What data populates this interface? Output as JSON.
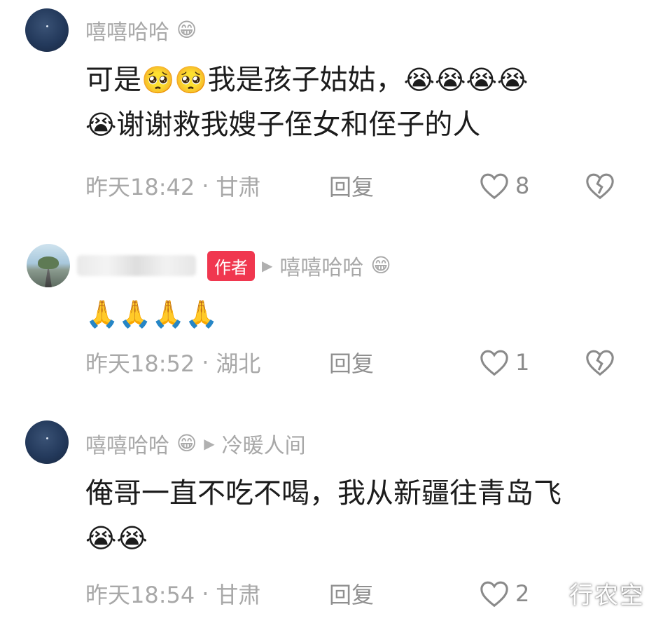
{
  "comments": [
    {
      "username": "嘻嘻哈哈",
      "username_emoji": "😁",
      "text_before": "可是",
      "text_emoji1": "🥺🥺",
      "text_mid": "我是孩子姑姑，",
      "text_emoji2": "😭😭😭😭",
      "text_emoji3": "😭",
      "text_after": "谢谢救我嫂子侄女和侄子的人",
      "time": "昨天18:42",
      "sep": "·",
      "location": "甘肃",
      "reply": "回复",
      "likes": "8",
      "like_icon": "heart-outline-icon",
      "dislike_icon": "broken-heart-icon"
    },
    {
      "author_tag": "作者",
      "reply_to_arrow": "▶",
      "reply_to": "嘻嘻哈哈",
      "reply_to_emoji": "😁",
      "text": "🙏🙏🙏🙏",
      "time": "昨天18:52",
      "sep": "·",
      "location": "湖北",
      "reply": "回复",
      "likes": "1"
    },
    {
      "username": "嘻嘻哈哈",
      "username_emoji": "😁",
      "reply_to_arrow": "▶",
      "reply_to": "冷暖人间",
      "text": "俺哥一直不吃不喝，我从新疆往青岛飞",
      "text_emoji": "😭😭",
      "time": "昨天18:54",
      "sep": "·",
      "location": "甘肃",
      "reply": "回复",
      "likes": "2"
    }
  ],
  "watermark": "行农空",
  "colors": {
    "author_tag": "#f0374f",
    "meta_text": "#a8a8a8",
    "body_text": "#1c1c1c"
  }
}
